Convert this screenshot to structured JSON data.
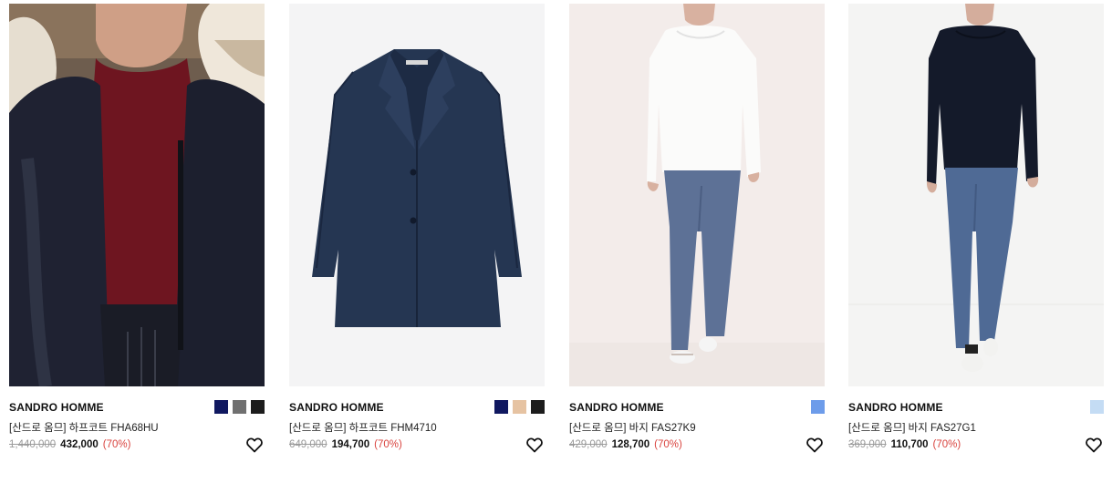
{
  "products": [
    {
      "brand": "SANDRO HOMME",
      "name": "[산드로 옴므] 하프코트 FHA68HU",
      "original_price": "1,440,000",
      "sale_price": "432,000",
      "discount": "(70%)",
      "swatches": [
        "#101860",
        "#707070",
        "#1c1c1c"
      ],
      "image_icon": "fur-hood-parka-photo"
    },
    {
      "brand": "SANDRO HOMME",
      "name": "[산드로 옴므] 하프코트 FHM4710",
      "original_price": "649,000",
      "sale_price": "194,700",
      "discount": "(70%)",
      "swatches": [
        "#101860",
        "#e6c3a2",
        "#1c1c1c"
      ],
      "image_icon": "navy-half-coat-photo"
    },
    {
      "brand": "SANDRO HOMME",
      "name": "[산드로 옴므] 바지 FAS27K9",
      "original_price": "429,000",
      "sale_price": "128,700",
      "discount": "(70%)",
      "swatches": [
        "#6d9cea"
      ],
      "image_icon": "blue-trousers-photo"
    },
    {
      "brand": "SANDRO HOMME",
      "name": "[산드로 옴므] 바지 FAS27G1",
      "original_price": "369,000",
      "sale_price": "110,700",
      "discount": "(70%)",
      "swatches": [
        "#c4dcf4"
      ],
      "image_icon": "blue-trousers-photo"
    }
  ]
}
